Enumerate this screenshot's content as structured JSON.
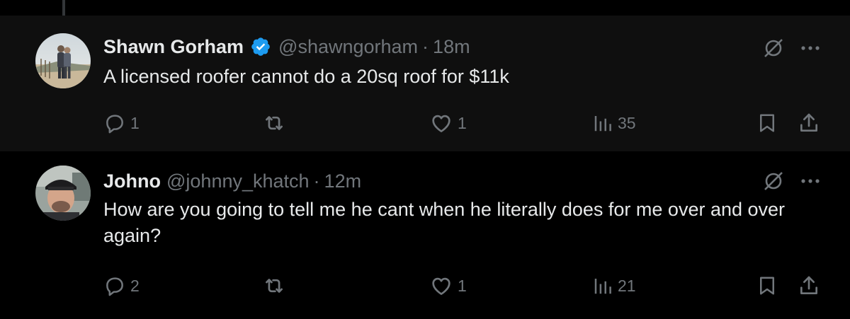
{
  "tweets": [
    {
      "name": "Shawn Gorham",
      "verified": true,
      "handle": "@shawngorham",
      "separator": "·",
      "time": "18m",
      "text": "A licensed roofer cannot do a 20sq roof for $11k",
      "reply_count": "1",
      "like_count": "1",
      "view_count": "35"
    },
    {
      "name": "Johno",
      "verified": false,
      "handle": "@johnny_khatch",
      "separator": "·",
      "time": "12m",
      "text": "How are you going to tell me he cant when he literally does for me over and over again?",
      "reply_count": "2",
      "like_count": "1",
      "view_count": "21"
    }
  ],
  "colors": {
    "background": "#000000",
    "highlight_background": "#0f0f0f",
    "text_primary": "#e7e9ea",
    "text_secondary": "#71767b",
    "verified_blue": "#1d9bf0",
    "thread_line": "#333639"
  },
  "icons": {
    "grok": "grok-icon",
    "more": "more-icon",
    "reply": "reply-icon",
    "retweet": "retweet-icon",
    "like": "like-icon",
    "views": "views-icon",
    "bookmark": "bookmark-icon",
    "share": "share-icon",
    "verified": "verified-badge-icon"
  }
}
